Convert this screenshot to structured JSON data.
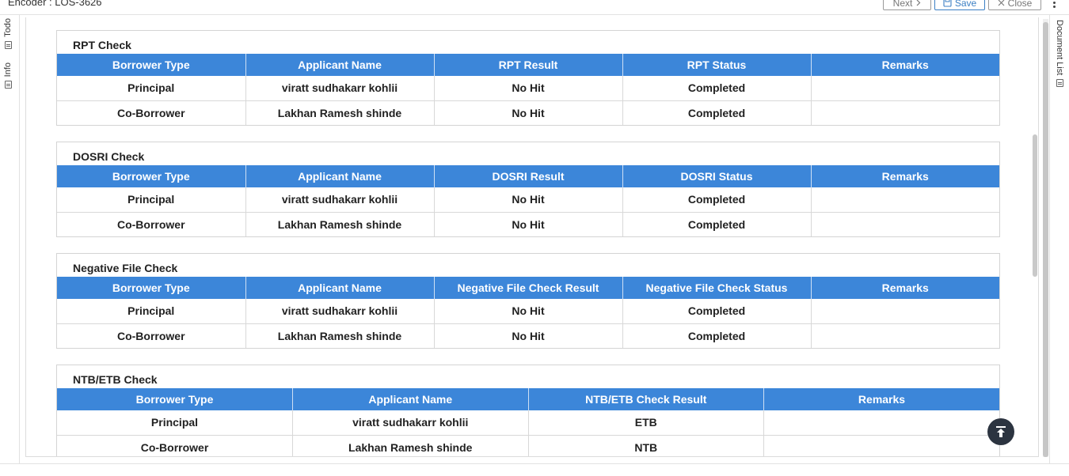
{
  "header": {
    "title": "Encoder : LOS-3626",
    "next_label": "Next",
    "save_label": "Save",
    "close_label": "Close"
  },
  "left_rail": {
    "todo_label": "Todo",
    "info_label": "Info"
  },
  "right_rail": {
    "doclist_label": "Document List"
  },
  "sections": [
    {
      "title": "RPT Check",
      "columns": [
        "Borrower Type",
        "Applicant Name",
        "RPT Result",
        "RPT Status",
        "Remarks"
      ],
      "rows": [
        [
          "Principal",
          "viratt sudhakarr kohlii",
          "No Hit",
          "Completed",
          ""
        ],
        [
          "Co-Borrower",
          "Lakhan Ramesh shinde",
          "No Hit",
          "Completed",
          ""
        ]
      ]
    },
    {
      "title": "DOSRI Check",
      "columns": [
        "Borrower Type",
        "Applicant Name",
        "DOSRI Result",
        "DOSRI Status",
        "Remarks"
      ],
      "rows": [
        [
          "Principal",
          "viratt sudhakarr kohlii",
          "No Hit",
          "Completed",
          ""
        ],
        [
          "Co-Borrower",
          "Lakhan Ramesh shinde",
          "No Hit",
          "Completed",
          ""
        ]
      ]
    },
    {
      "title": "Negative File Check",
      "columns": [
        "Borrower Type",
        "Applicant Name",
        "Negative File Check Result",
        "Negative File Check Status",
        "Remarks"
      ],
      "rows": [
        [
          "Principal",
          "viratt sudhakarr kohlii",
          "No Hit",
          "Completed",
          ""
        ],
        [
          "Co-Borrower",
          "Lakhan Ramesh shinde",
          "No Hit",
          "Completed",
          ""
        ]
      ]
    },
    {
      "title": "NTB/ETB Check",
      "columns": [
        "Borrower Type",
        "Applicant Name",
        "NTB/ETB Check Result",
        "Remarks"
      ],
      "rows": [
        [
          "Principal",
          "viratt sudhakarr kohlii",
          "ETB",
          ""
        ],
        [
          "Co-Borrower",
          "Lakhan Ramesh shinde",
          "NTB",
          ""
        ]
      ]
    }
  ],
  "colors": {
    "table_header_bg": "#3c86d9",
    "scroll_top_bg": "#2c3440"
  },
  "icons": {
    "scroll_top": "arrow-up-to-line-icon",
    "save": "save-icon",
    "next": "chevron-right-icon",
    "close": "close-icon",
    "more": "kebab-icon"
  }
}
